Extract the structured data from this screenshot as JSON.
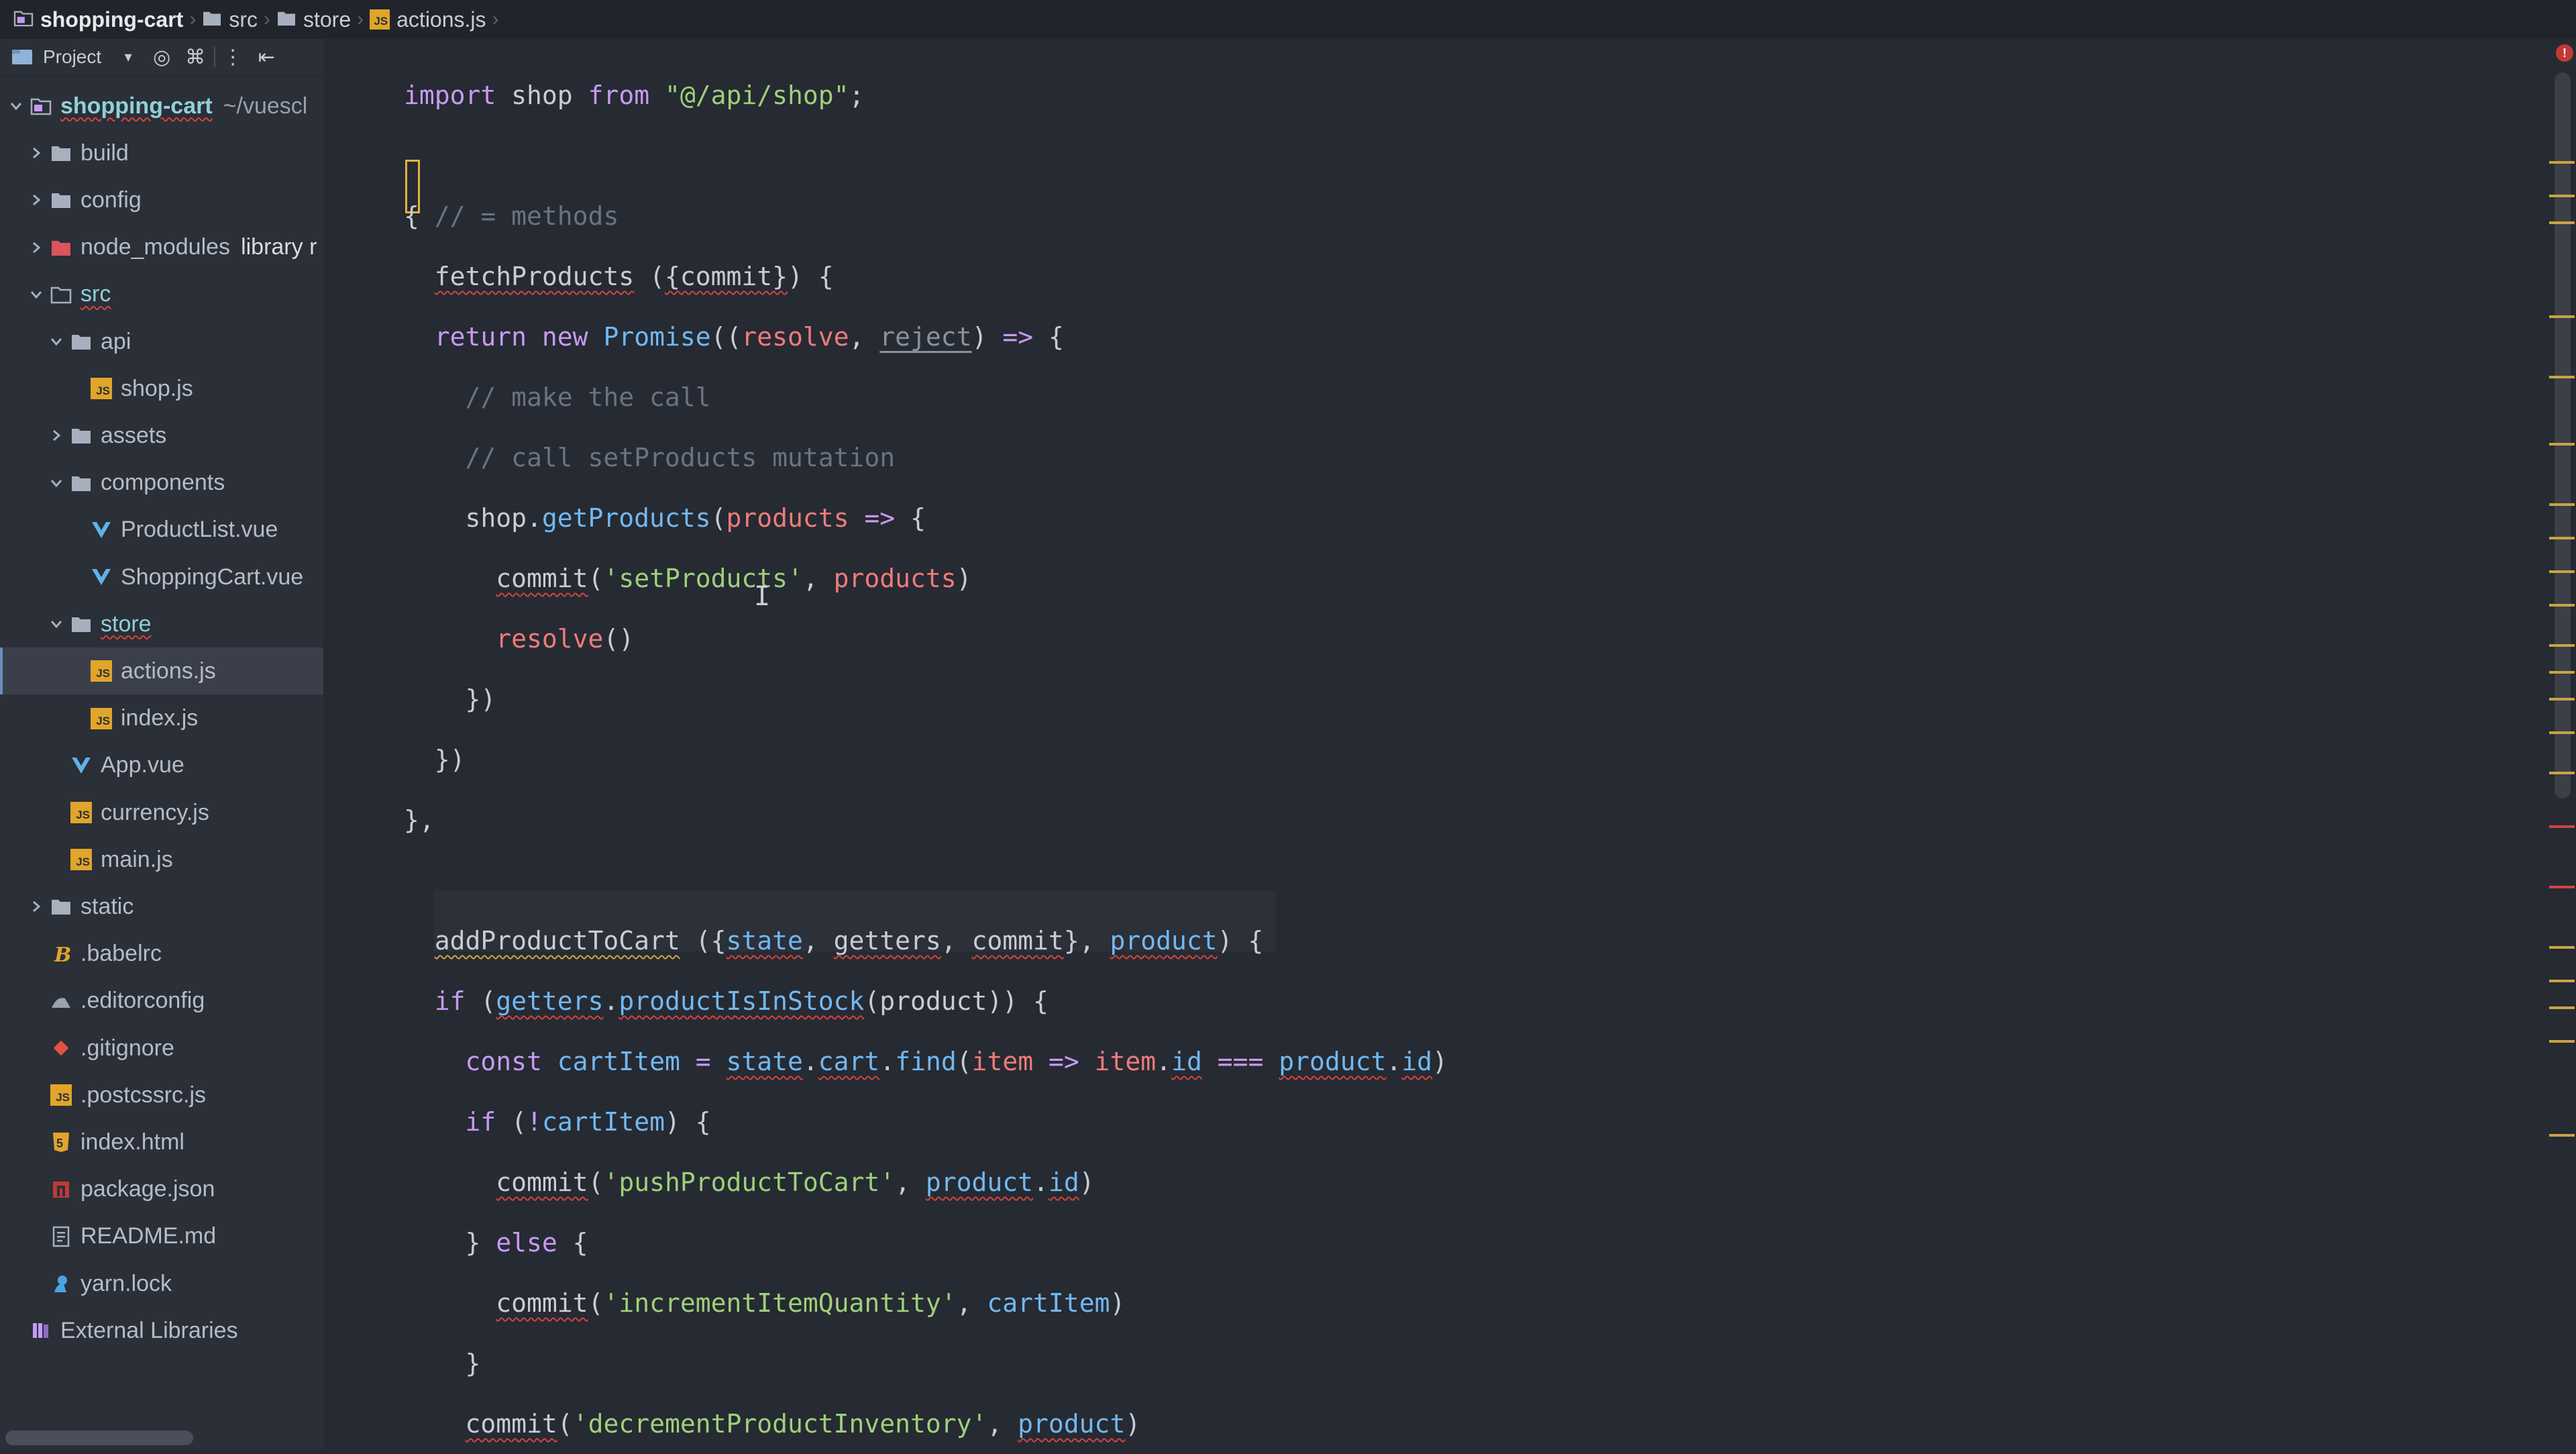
{
  "breadcrumbs": [
    {
      "label": "shopping-cart",
      "icon": "project-folder-icon",
      "bold": true
    },
    {
      "label": "src",
      "icon": "folder-icon"
    },
    {
      "label": "store",
      "icon": "folder-icon"
    },
    {
      "label": "actions.js",
      "icon": "js-file-icon"
    }
  ],
  "sidebar": {
    "toolbar": {
      "view_label": "Project"
    },
    "tree": [
      {
        "label": "shopping-cart",
        "suffix": "~/vuescl",
        "icon": "project-folder-icon",
        "expanded": true
      },
      {
        "label": "build",
        "icon": "folder-icon"
      },
      {
        "label": "config",
        "icon": "folder-icon"
      },
      {
        "label": "node_modules",
        "suffix": "library r",
        "icon": "excluded-folder-icon"
      },
      {
        "label": "src",
        "icon": "source-folder-icon",
        "expanded": true
      },
      {
        "label": "api",
        "icon": "folder-icon",
        "expanded": true
      },
      {
        "label": "shop.js",
        "icon": "js-file-icon"
      },
      {
        "label": "assets",
        "icon": "folder-icon"
      },
      {
        "label": "components",
        "icon": "folder-icon",
        "expanded": true
      },
      {
        "label": "ProductList.vue",
        "icon": "vue-file-icon"
      },
      {
        "label": "ShoppingCart.vue",
        "icon": "vue-file-icon"
      },
      {
        "label": "store",
        "icon": "folder-icon",
        "expanded": true
      },
      {
        "label": "actions.js",
        "icon": "js-file-icon",
        "selected": true
      },
      {
        "label": "index.js",
        "icon": "js-file-icon"
      },
      {
        "label": "App.vue",
        "icon": "vue-file-icon"
      },
      {
        "label": "currency.js",
        "icon": "js-file-icon"
      },
      {
        "label": "main.js",
        "icon": "js-file-icon"
      },
      {
        "label": "static",
        "icon": "folder-icon"
      },
      {
        "label": ".babelrc",
        "icon": "babel-file-icon"
      },
      {
        "label": ".editorconfig",
        "icon": "editorconfig-file-icon"
      },
      {
        "label": ".gitignore",
        "icon": "git-file-icon"
      },
      {
        "label": ".postcssrc.js",
        "icon": "js-file-icon"
      },
      {
        "label": "index.html",
        "icon": "html-file-icon"
      },
      {
        "label": "package.json",
        "icon": "npm-file-icon"
      },
      {
        "label": "README.md",
        "icon": "markdown-file-icon"
      },
      {
        "label": "yarn.lock",
        "icon": "yarn-file-icon"
      },
      {
        "label": "External Libraries",
        "icon": "library-icon"
      }
    ]
  },
  "editor": {
    "lines": [
      [
        [
          "kw",
          "import"
        ],
        [
          "pl",
          " shop "
        ],
        [
          "kw",
          "from"
        ],
        [
          "pl",
          " "
        ],
        [
          "str",
          "\"@/api/shop\""
        ],
        [
          "pl",
          ";"
        ]
      ],
      [],
      [
        [
          "pl",
          "{"
        ],
        [
          "pl",
          " "
        ],
        [
          "cm",
          "// = methods"
        ]
      ],
      [
        [
          "pl",
          "  "
        ],
        [
          "pl",
          "fetchProducts"
        ],
        [
          "pl",
          " ("
        ],
        [
          "pl",
          "{commit}"
        ],
        [
          "pl",
          ")"
        ],
        [
          "pl",
          " {"
        ]
      ],
      [
        [
          "pl",
          "  "
        ],
        [
          "kw",
          "return new "
        ],
        [
          "fn",
          "Promise"
        ],
        [
          "pl",
          "(("
        ],
        [
          "pm",
          "resolve"
        ],
        [
          "pl",
          ", "
        ],
        [
          "dim",
          "reject"
        ],
        [
          "pl",
          ") "
        ],
        [
          "op",
          "=>"
        ],
        [
          "pl",
          " {"
        ]
      ],
      [
        [
          "pl",
          "    "
        ],
        [
          "cm",
          "// make the call"
        ]
      ],
      [
        [
          "pl",
          "    "
        ],
        [
          "cm",
          "// call setProducts mutation"
        ]
      ],
      [
        [
          "pl",
          "    shop."
        ],
        [
          "fn",
          "getProducts"
        ],
        [
          "pl",
          "("
        ],
        [
          "pm",
          "products"
        ],
        [
          "pl",
          " "
        ],
        [
          "op",
          "=>"
        ],
        [
          "pl",
          " {"
        ]
      ],
      [
        [
          "pl",
          "      "
        ],
        [
          "pl",
          "commit"
        ],
        [
          "pl",
          "("
        ],
        [
          "str",
          "'setProducts'"
        ],
        [
          "pl",
          ", "
        ],
        [
          "pm",
          "products"
        ],
        [
          "pl",
          ")"
        ]
      ],
      [
        [
          "pl",
          "      "
        ],
        [
          "pm",
          "resolve"
        ],
        [
          "pl",
          "()"
        ]
      ],
      [
        [
          "pl",
          "    })"
        ]
      ],
      [
        [
          "pl",
          "  })"
        ]
      ],
      [
        [
          "pl",
          "},"
        ]
      ],
      [],
      [
        [
          "pl",
          "  "
        ],
        [
          "pl",
          "addProductToCart"
        ],
        [
          "pl",
          " ({"
        ],
        [
          "fn",
          "state"
        ],
        [
          "pl",
          ", "
        ],
        [
          "pl",
          "getters"
        ],
        [
          "pl",
          ", "
        ],
        [
          "pl",
          "commit"
        ],
        [
          "pl",
          "}, "
        ],
        [
          "fn",
          "product"
        ],
        [
          "pl",
          ")"
        ],
        [
          "pl",
          " {"
        ]
      ],
      [
        [
          "pl",
          "  "
        ],
        [
          "kw",
          "if"
        ],
        [
          "pl",
          " ("
        ],
        [
          "fn",
          "getters"
        ],
        [
          "pl",
          "."
        ],
        [
          "fn",
          "productIsInStock"
        ],
        [
          "pl",
          "(product)) {"
        ]
      ],
      [
        [
          "pl",
          "    "
        ],
        [
          "kw",
          "const "
        ],
        [
          "fn",
          "cartItem"
        ],
        [
          "pl",
          " "
        ],
        [
          "op",
          "="
        ],
        [
          "pl",
          " "
        ],
        [
          "fn",
          "state"
        ],
        [
          "pl",
          "."
        ],
        [
          "fn",
          "cart"
        ],
        [
          "pl",
          "."
        ],
        [
          "fn",
          "find"
        ],
        [
          "pl",
          "("
        ],
        [
          "pm",
          "item"
        ],
        [
          "pl",
          " "
        ],
        [
          "op",
          "=>"
        ],
        [
          "pl",
          " "
        ],
        [
          "pm",
          "item"
        ],
        [
          "pl",
          "."
        ],
        [
          "fn",
          "id"
        ],
        [
          "pl",
          " "
        ],
        [
          "op",
          "==="
        ],
        [
          "pl",
          " "
        ],
        [
          "fn",
          "product"
        ],
        [
          "pl",
          "."
        ],
        [
          "fn",
          "id"
        ],
        [
          "pl",
          ")"
        ]
      ],
      [
        [
          "pl",
          "    "
        ],
        [
          "kw",
          "if"
        ],
        [
          "pl",
          " ("
        ],
        [
          "op",
          "!"
        ],
        [
          "fn",
          "cartItem"
        ],
        [
          "pl",
          ") {"
        ]
      ],
      [
        [
          "pl",
          "      "
        ],
        [
          "pl",
          "commit"
        ],
        [
          "pl",
          "("
        ],
        [
          "str",
          "'pushProductToCart'"
        ],
        [
          "pl",
          ", "
        ],
        [
          "fn",
          "product"
        ],
        [
          "pl",
          "."
        ],
        [
          "fn",
          "id"
        ],
        [
          "pl",
          ")"
        ]
      ],
      [
        [
          "pl",
          "    } "
        ],
        [
          "kw",
          "else"
        ],
        [
          "pl",
          " {"
        ]
      ],
      [
        [
          "pl",
          "      "
        ],
        [
          "pl",
          "commit"
        ],
        [
          "pl",
          "("
        ],
        [
          "str",
          "'incrementItemQuantity'"
        ],
        [
          "pl",
          ", "
        ],
        [
          "fn",
          "cartItem"
        ],
        [
          "pl",
          ")"
        ]
      ],
      [
        [
          "pl",
          "    }"
        ]
      ],
      [
        [
          "pl",
          "    "
        ],
        [
          "pl",
          "commit"
        ],
        [
          "pl",
          "("
        ],
        [
          "str",
          "'decrementProductInventory'"
        ],
        [
          "pl",
          ", "
        ],
        [
          "fn",
          "product"
        ],
        [
          "pl",
          ")"
        ]
      ]
    ]
  },
  "colors": {
    "keyword": "#c79af2",
    "string": "#9ed07a",
    "comment": "#6b7280",
    "function": "#72b8f2",
    "param": "#ef7b7b",
    "error": "#d0453f",
    "warning": "#c9a443"
  }
}
